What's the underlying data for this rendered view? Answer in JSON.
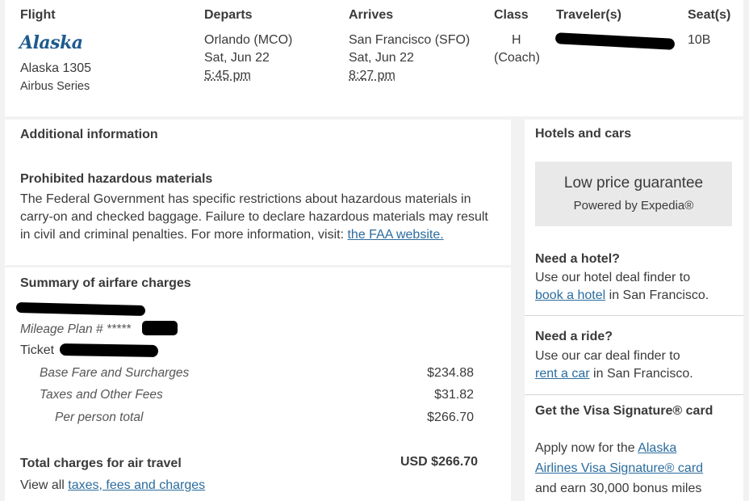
{
  "flight_table": {
    "headers": {
      "flight": "Flight",
      "departs": "Departs",
      "arrives": "Arrives",
      "class": "Class",
      "travelers": "Traveler(s)",
      "seats": "Seat(s)"
    },
    "airline_logo": "Alaska",
    "flight_number": "Alaska 1305",
    "aircraft": "Airbus Series",
    "depart_city": "Orlando (MCO)",
    "depart_date": "Sat, Jun 22",
    "depart_time": "5:45 pm",
    "arrive_city": "San Francisco (SFO)",
    "arrive_date": "Sat, Jun 22",
    "arrive_time": "8:27 pm",
    "class_code": "H",
    "class_name": "(Coach)",
    "seat": "10B"
  },
  "additional_info": {
    "title": "Additional information",
    "hazmat_title": "Prohibited hazardous materials",
    "hazmat_line1": "The Federal Government has specific restrictions about hazardous materials in",
    "hazmat_line2": "carry-on and checked baggage. Failure to declare hazardous materials may result",
    "hazmat_line3": "in civil and criminal penalties. For more information, visit:",
    "hazmat_link": "the FAA website."
  },
  "summary": {
    "title": "Summary of airfare charges",
    "mileage_plan": "Mileage Plan # *****",
    "ticket_label": "Ticket",
    "rows": [
      {
        "label": "Base Fare and Surcharges",
        "amount": "$234.88"
      },
      {
        "label": "Taxes and Other Fees",
        "amount": "$31.82"
      },
      {
        "label": "Per person total",
        "amount": "$266.70"
      }
    ],
    "total_label": "Total charges for air travel",
    "total_amount": "USD $266.70",
    "view_all_prefix": "View all",
    "view_all_link": "taxes, fees and charges"
  },
  "sidebar": {
    "hotels_title": "Hotels and cars",
    "promo_title": "Low price guarantee",
    "promo_sub": "Powered by Expedia®",
    "hotel_title": "Need a hotel?",
    "hotel_line1": "Use our hotel deal finder to",
    "hotel_link": "book a hotel",
    "hotel_suffix": "in San Francisco.",
    "ride_title": "Need a ride?",
    "ride_line1": "Use our car deal finder to",
    "ride_link": "rent a car",
    "ride_suffix": "in San Francisco.",
    "visa_title": "Get the Visa Signature® card",
    "visa_prefix": "Apply now for the",
    "visa_link1": "Alaska",
    "visa_link2": "Airlines Visa Signature® card",
    "visa_line3": "and earn 30,000 bonus miles"
  },
  "colors": {
    "link": "#2b6c9e",
    "logo": "#1e5a8e",
    "promo_bg": "#e9e9e9",
    "redaction": "#000000"
  }
}
